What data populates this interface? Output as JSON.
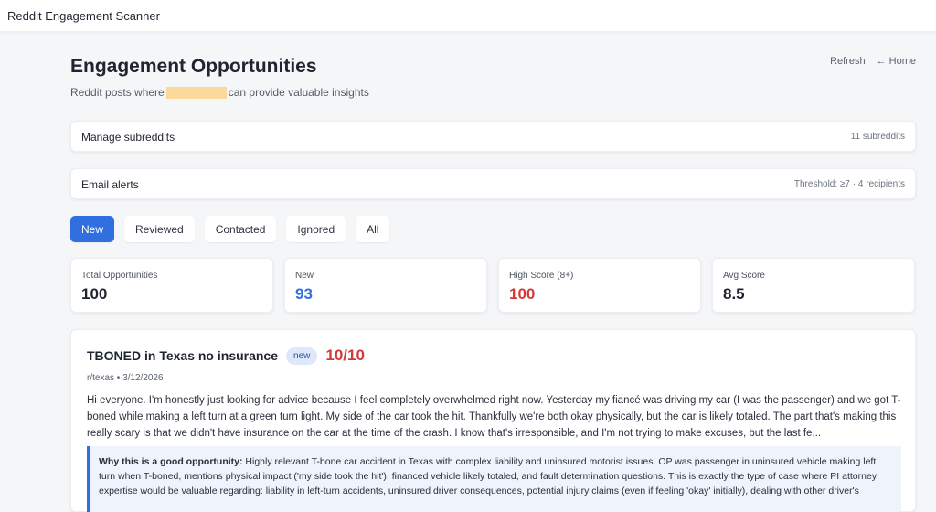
{
  "app": {
    "title": "Reddit Engagement Scanner"
  },
  "header": {
    "title": "Engagement Opportunities",
    "subtitle_before": "Reddit posts where",
    "subtitle_after": "can provide valuable insights",
    "refresh_label": "Refresh",
    "home_label": "← Home"
  },
  "subreddits": {
    "label": "Manage subreddits",
    "meta": "11 subreddits"
  },
  "alerts": {
    "label": "Email alerts",
    "meta": "Threshold: ≥7 · 4 recipients"
  },
  "tabs": [
    {
      "label": "New",
      "active": true
    },
    {
      "label": "Reviewed"
    },
    {
      "label": "Contacted"
    },
    {
      "label": "Ignored"
    },
    {
      "label": "All"
    }
  ],
  "stats": [
    {
      "label": "Total Opportunities",
      "value": "100",
      "color": "#1f2430"
    },
    {
      "label": "New",
      "value": "93",
      "color": "#2f6fe0"
    },
    {
      "label": "High Score (8+)",
      "value": "100",
      "color": "#d23a3a"
    },
    {
      "label": "Avg Score",
      "value": "8.5",
      "color": "#1f2430"
    }
  ],
  "post": {
    "title": "TBONED in Texas no insurance",
    "badge": "new",
    "score": "10/10",
    "meta": "r/texas • 3/12/2026",
    "body": "Hi everyone. I'm honestly just looking for advice because I feel completely overwhelmed right now. Yesterday my fiancé was driving my car (I was the passenger) and we got T-boned while making a left turn at a green turn light. My side of the car took the hit. Thankfully we're both okay physically, but the car is likely totaled. The part that's making this really scary is that we didn't have insurance on the car at the time of the crash. I know that's irresponsible, and I'm not trying to make excuses, but the last fe...",
    "why_label": "Why this is a good opportunity:",
    "why_text": "Highly relevant T-bone car accident in Texas with complex liability and uninsured motorist issues. OP was passenger in uninsured vehicle making left turn when T-boned, mentions physical impact ('my side took the hit'), financed vehicle likely totaled, and fault determination questions. This is exactly the type of case where PI attorney expertise would be valuable regarding: liability in left-turn accidents, uninsured driver consequences, potential injury claims (even if feeling 'okay' initially), dealing with other driver's"
  },
  "colors": {
    "accent": "#2f6fe0",
    "score_red": "#d23a3a",
    "redaction": "#fbd99a"
  }
}
